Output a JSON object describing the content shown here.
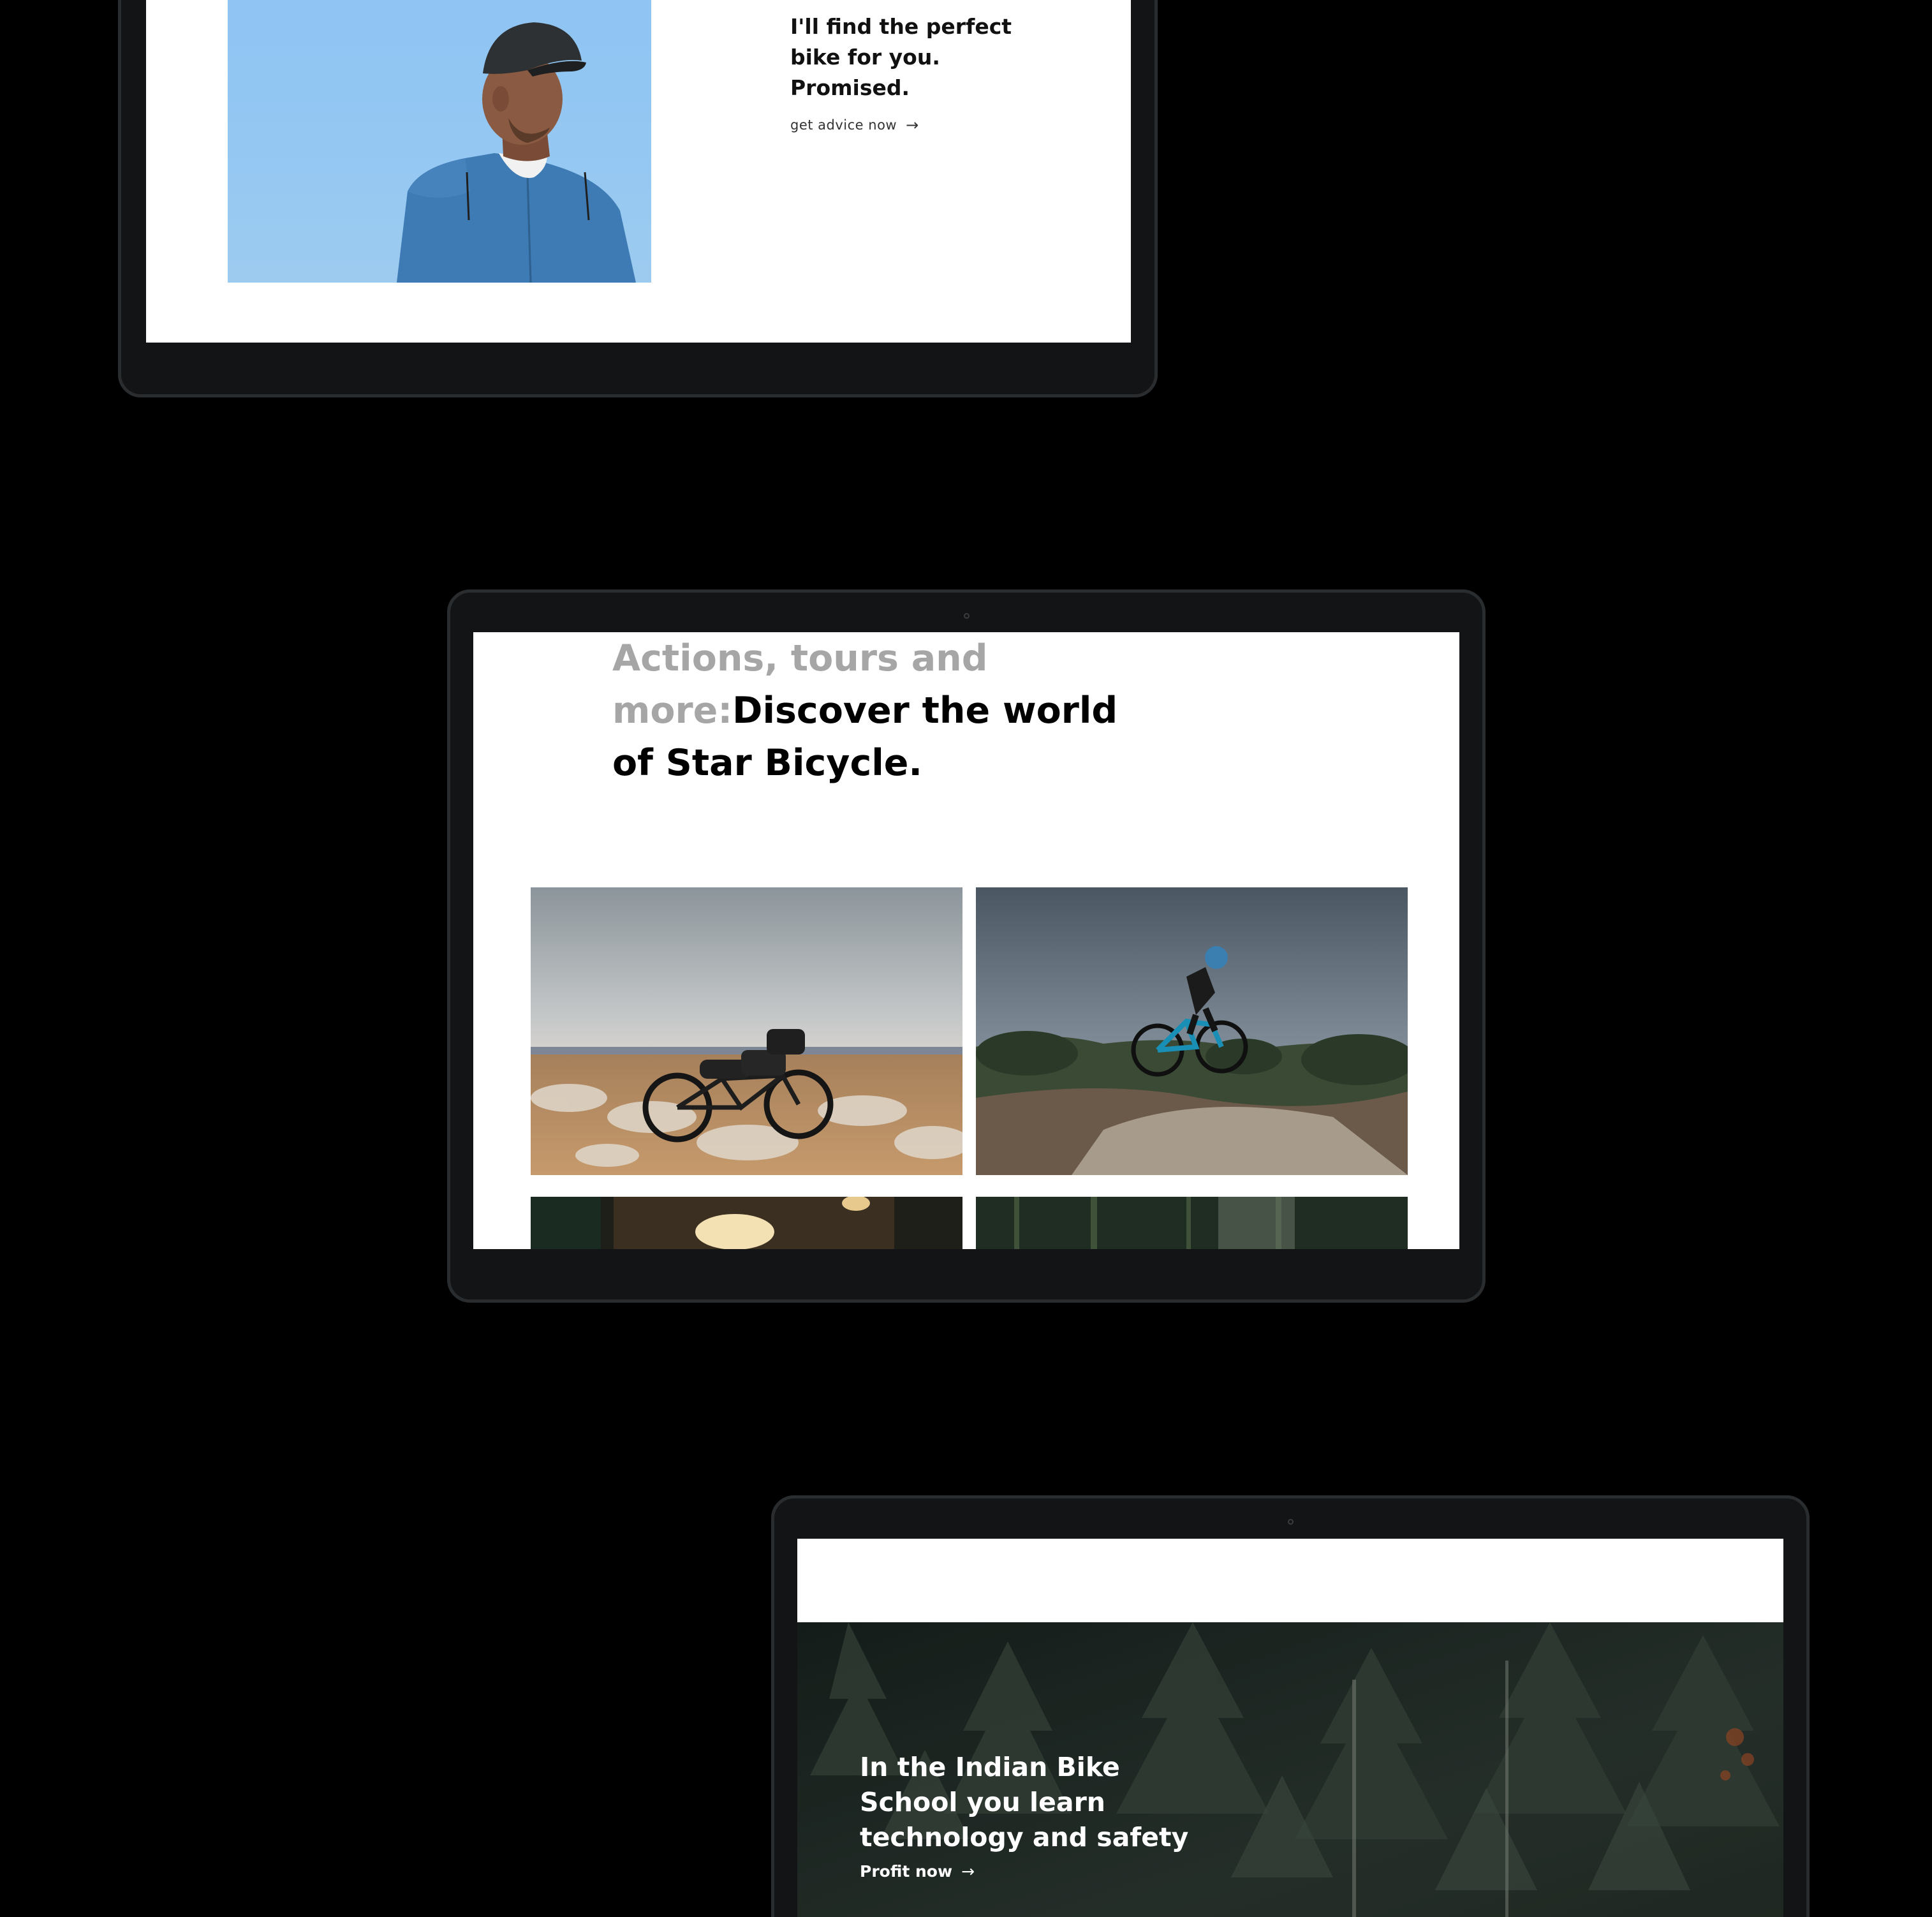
{
  "advice_section": {
    "title": "I'll find the perfect\nbike for you.\nPromised.",
    "link_label": "get advice now",
    "link_icon": "arrow-right-icon"
  },
  "world_section": {
    "heading_muted": "Actions, tours and more:",
    "heading_main": "Discover the world of Star Bicycle."
  },
  "school_section": {
    "title": "In the Indian Bike School you learn technology and safety",
    "link_label": "Profit now",
    "link_icon": "arrow-right-icon"
  },
  "colors": {
    "page_background": "#000000",
    "device_bezel": "#121415",
    "sky_blue": "#8fc4f3",
    "muted_heading": "#a6a6a6",
    "forest": "#25302f"
  }
}
